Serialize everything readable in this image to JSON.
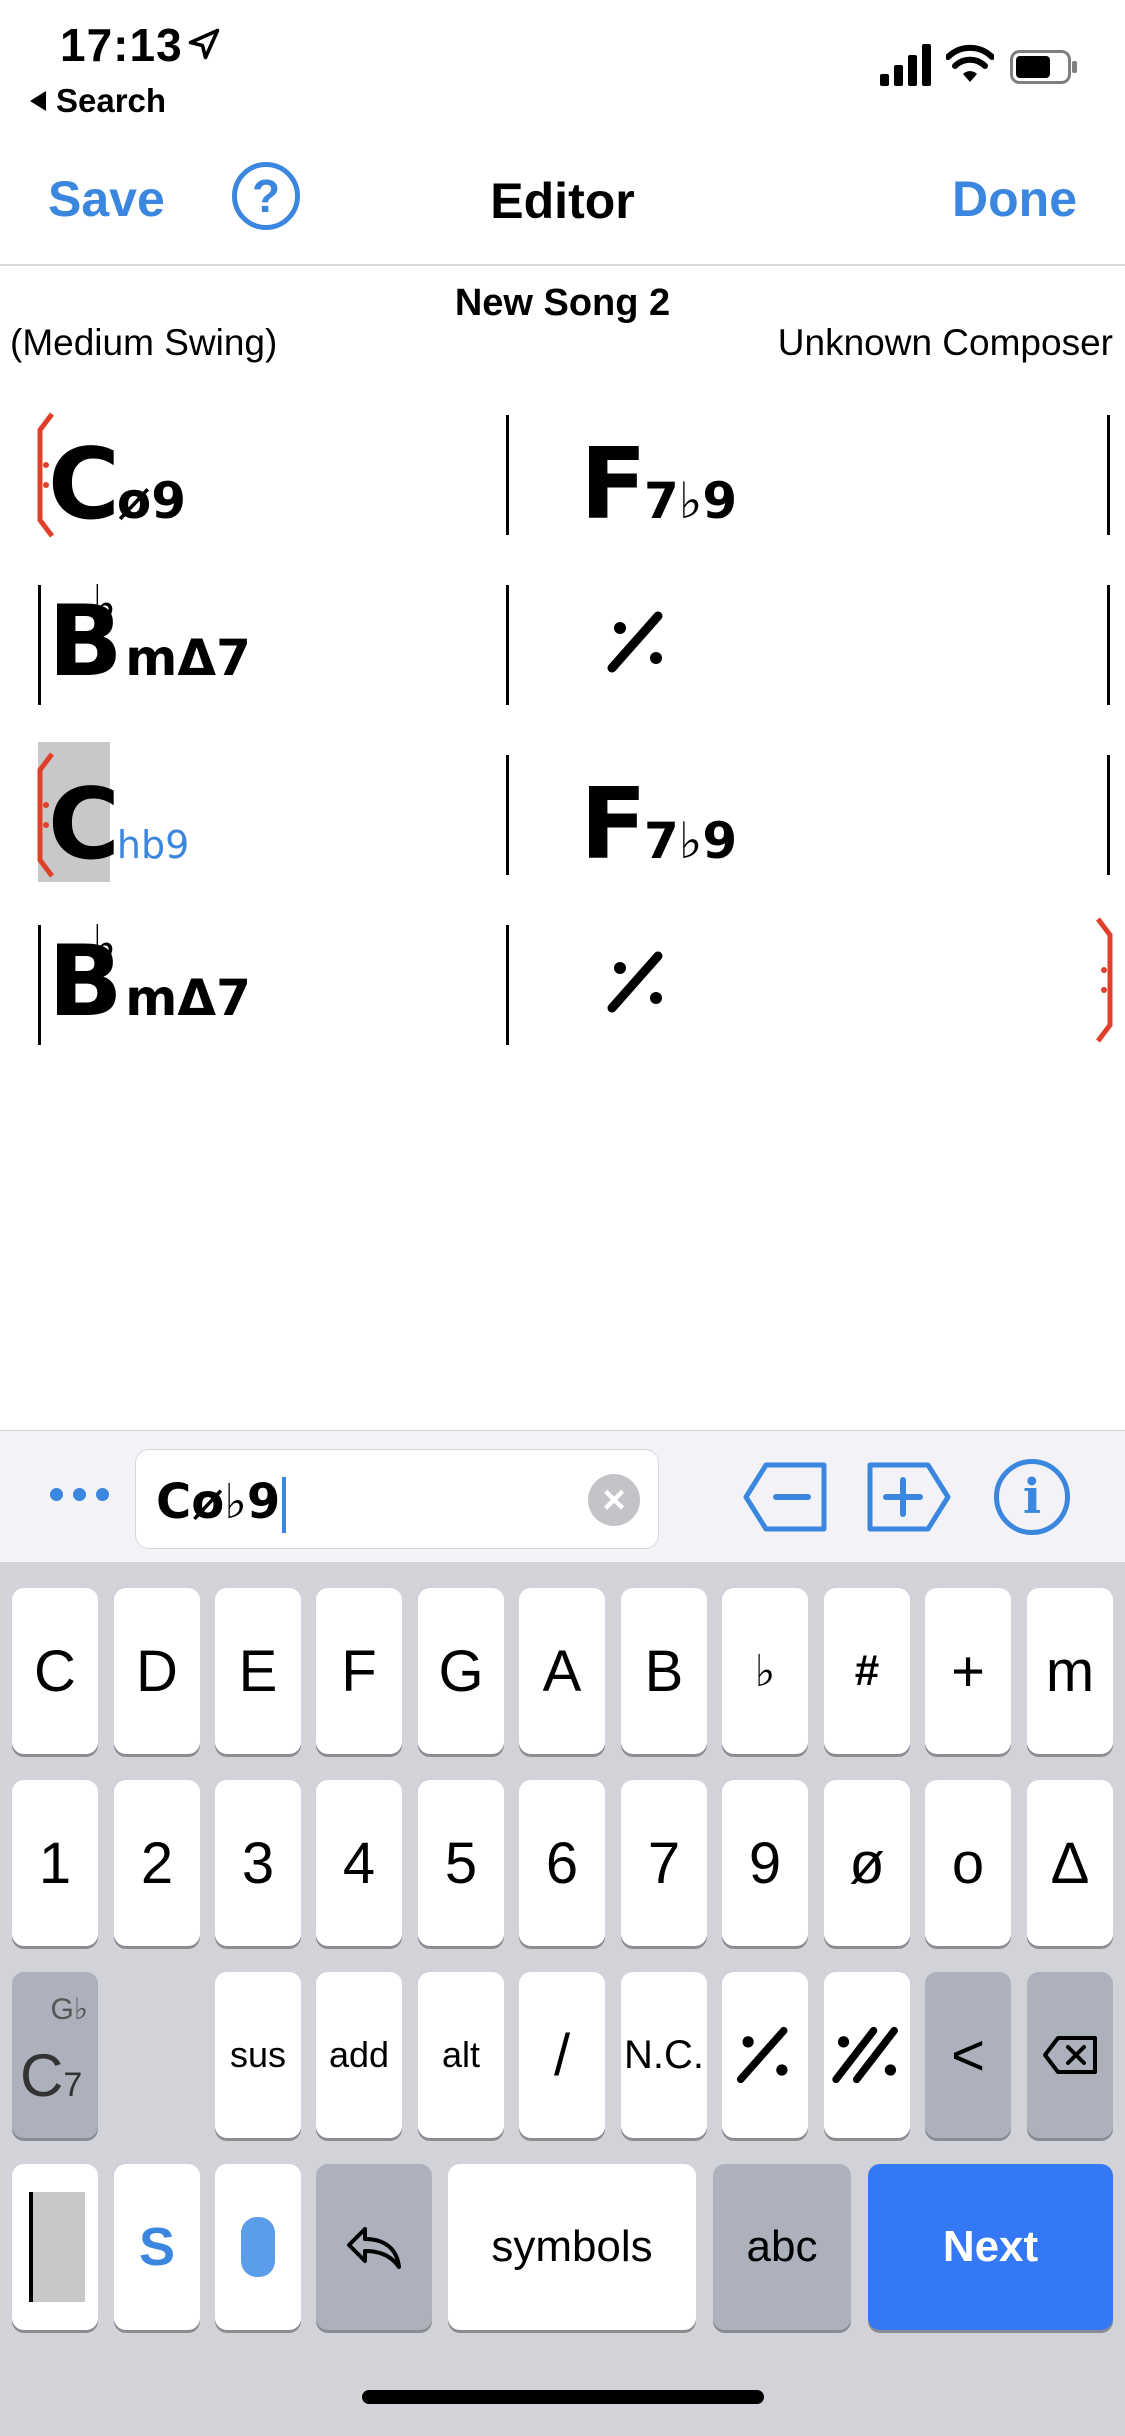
{
  "status_bar": {
    "time": "17:13",
    "back_label": "Search"
  },
  "nav": {
    "save_label": "Save",
    "help_label": "?",
    "title": "Editor",
    "done_label": "Done"
  },
  "song": {
    "title": "New Song 2",
    "style": "(Medium Swing)",
    "composer": "Unknown Composer"
  },
  "chart": {
    "rows": [
      {
        "bars": [
          {
            "root": "C",
            "accidental": "",
            "quality": "ø9"
          },
          {
            "root": "F",
            "accidental": "",
            "quality": "7♭9"
          }
        ]
      },
      {
        "bars": [
          {
            "root": "B",
            "accidental": "♭",
            "quality": "mΔ7"
          },
          {
            "repeat": true
          }
        ]
      },
      {
        "bars": [
          {
            "root": "C",
            "accidental": "",
            "quality": "hb9",
            "selected": true
          },
          {
            "root": "F",
            "accidental": "",
            "quality": "7♭9"
          }
        ]
      },
      {
        "bars": [
          {
            "root": "B",
            "accidental": "♭",
            "quality": "mΔ7"
          },
          {
            "repeat": true
          }
        ]
      }
    ],
    "repeat_mark": "⁒"
  },
  "editor": {
    "more_label": "•••",
    "input_value": "Cø♭9",
    "clear_label": "×",
    "info_label": "i"
  },
  "keyboard": {
    "row1": [
      "C",
      "D",
      "E",
      "F",
      "G",
      "A",
      "B",
      "♭",
      "#",
      "+",
      "m"
    ],
    "row2": [
      "1",
      "2",
      "3",
      "4",
      "5",
      "6",
      "7",
      "9",
      "ø",
      "o",
      "Δ"
    ],
    "row3": [
      "sus",
      "add",
      "alt",
      "/",
      "N.C.",
      "⁒",
      "𝄎",
      "<",
      "⌫"
    ],
    "chord_key_root": "C",
    "chord_key_sub": "7",
    "chord_key_sup": "G♭",
    "s_key": "S",
    "symbols_label": "symbols",
    "abc_label": "abc",
    "next_label": "Next"
  },
  "colors": {
    "accent": "#3b86de",
    "bracket": "#e0402a",
    "next": "#3478f6"
  }
}
